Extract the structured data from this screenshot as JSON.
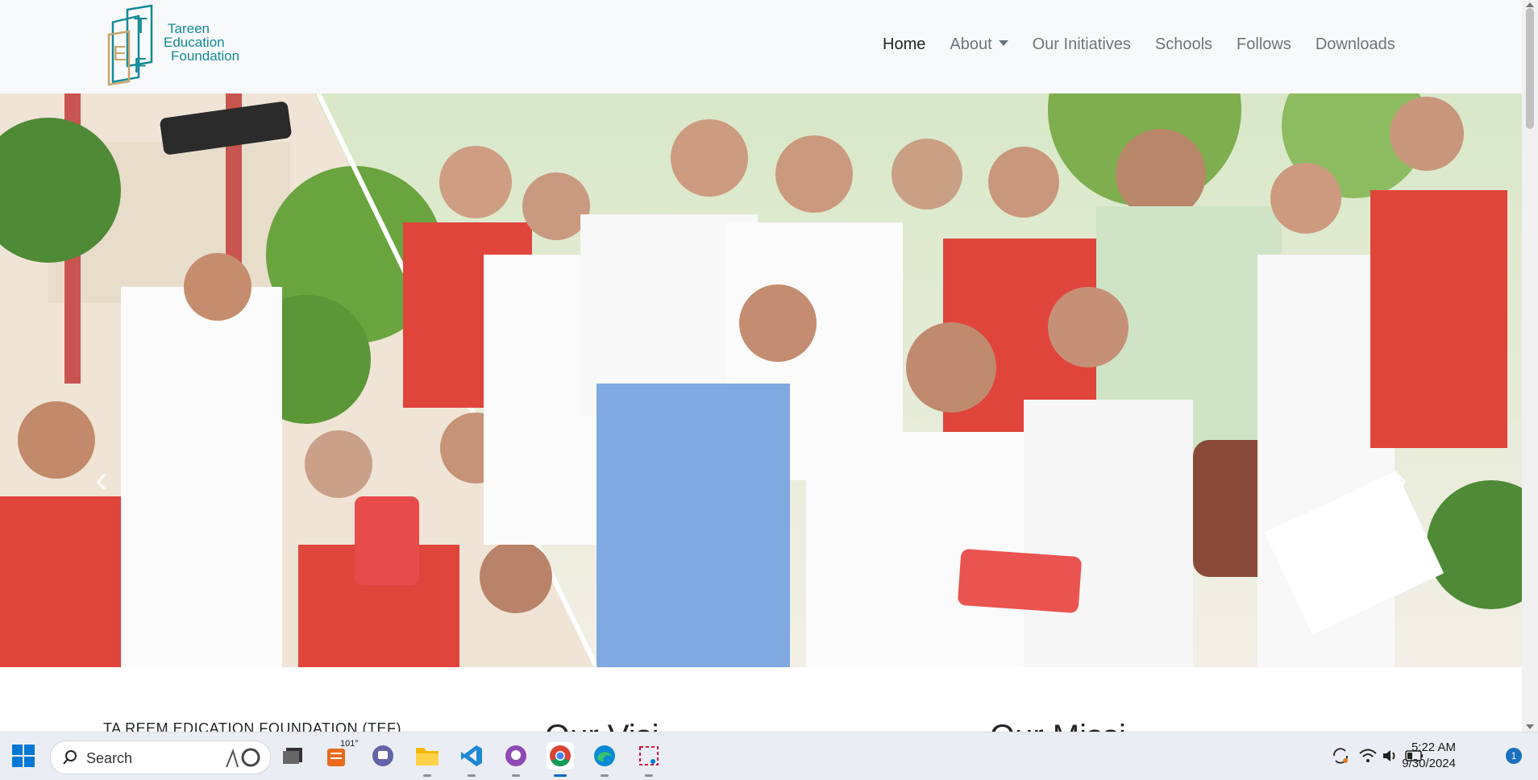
{
  "brand": {
    "logo_letters": [
      "E",
      "T",
      "F"
    ],
    "lines": [
      "Tareen",
      "Education",
      "Foundation"
    ],
    "teal": "#128a95",
    "gold": "#c9a66b"
  },
  "nav": {
    "items": [
      {
        "label": "Home",
        "active": true
      },
      {
        "label": "About",
        "dropdown": true
      },
      {
        "label": "Our Initiatives"
      },
      {
        "label": "Schools"
      },
      {
        "label": "Follows"
      },
      {
        "label": "Downloads"
      }
    ]
  },
  "hero": {
    "prev_icon": "chevron-left-icon",
    "next_icon": "chevron-right-icon",
    "prev_glyph": "‹",
    "next_glyph": "›"
  },
  "content": {
    "about_title": "TA REEM EDICATION FOUNDATION (TEF)",
    "vision_heading": "Our Visi",
    "mission_heading": "Our Missi"
  },
  "taskbar": {
    "search_placeholder": "Search",
    "weather_temp": "101°",
    "time": "5:22 AM",
    "date": "9/30/2024",
    "notification_count": "1",
    "apps": [
      "start-icon",
      "task-view-icon",
      "weather-icon",
      "teams-icon",
      "file-explorer-icon",
      "vscode-icon",
      "github-desktop-icon",
      "chrome-icon",
      "edge-icon",
      "snipping-tool-icon"
    ]
  },
  "colors": {
    "navbar_bg": "#f8f9fa",
    "active_link": "#212529",
    "link": "#6c757d",
    "uniform_red": "#e0453b",
    "taskbar_bg": "#eaeef4"
  }
}
